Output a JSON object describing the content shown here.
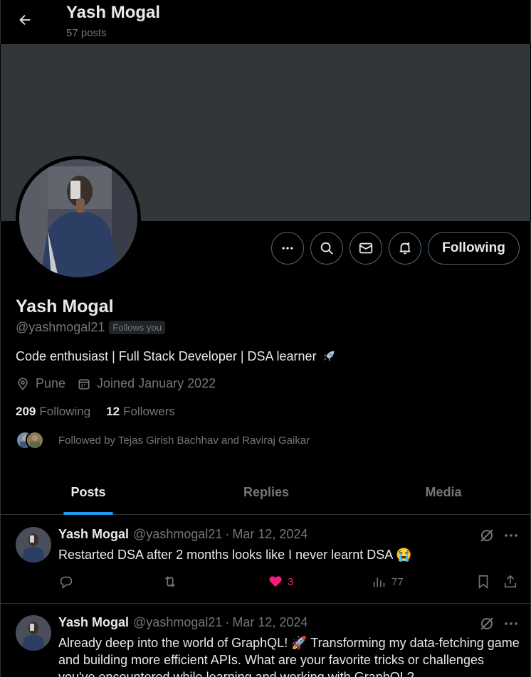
{
  "header": {
    "name": "Yash Mogal",
    "posts_count": "57 posts"
  },
  "profile": {
    "name": "Yash Mogal",
    "handle": "@yashmogal21",
    "follows_you": "Follows you",
    "bio": "Code enthusiast | Full Stack Developer | DSA learner",
    "location": "Pune",
    "joined": "Joined January 2022",
    "following_count": "209",
    "following_label": "Following",
    "followers_count": "12",
    "followers_label": "Followers",
    "followed_by": "Followed by Tejas Girish Bachhav and Raviraj Gaikar",
    "follow_button": "Following"
  },
  "tabs": [
    {
      "label": "Posts",
      "active": true
    },
    {
      "label": "Replies",
      "active": false
    },
    {
      "label": "Media",
      "active": false
    }
  ],
  "posts": [
    {
      "name": "Yash Mogal",
      "handle": "@yashmogal21",
      "dot": "·",
      "date": "Mar 12, 2024",
      "text": "Restarted DSA after 2 months looks like I never learnt DSA 😭",
      "likes": "3",
      "views": "77"
    },
    {
      "name": "Yash Mogal",
      "handle": "@yashmogal21",
      "dot": "·",
      "date": "Mar 12, 2024",
      "text": "Already deep into the world of GraphQL! 🚀 Transforming my data-fetching game and building more efficient APIs. What are your favorite tricks or challenges you've encountered while learning and working with GraphQL?"
    }
  ],
  "colors": {
    "background": "#000000",
    "text": "#e7e9ea",
    "muted": "#71767b",
    "accent": "#1d9bf0",
    "like": "#f91880",
    "banner": "#333639",
    "border": "#2f3336"
  },
  "icons": [
    "back-arrow-icon",
    "more-icon",
    "search-icon",
    "message-icon",
    "notification-bell-icon",
    "location-icon",
    "calendar-icon",
    "reply-icon",
    "repost-icon",
    "heart-icon",
    "views-icon",
    "bookmark-icon",
    "share-icon",
    "grok-icon",
    "rocket-emoji"
  ]
}
